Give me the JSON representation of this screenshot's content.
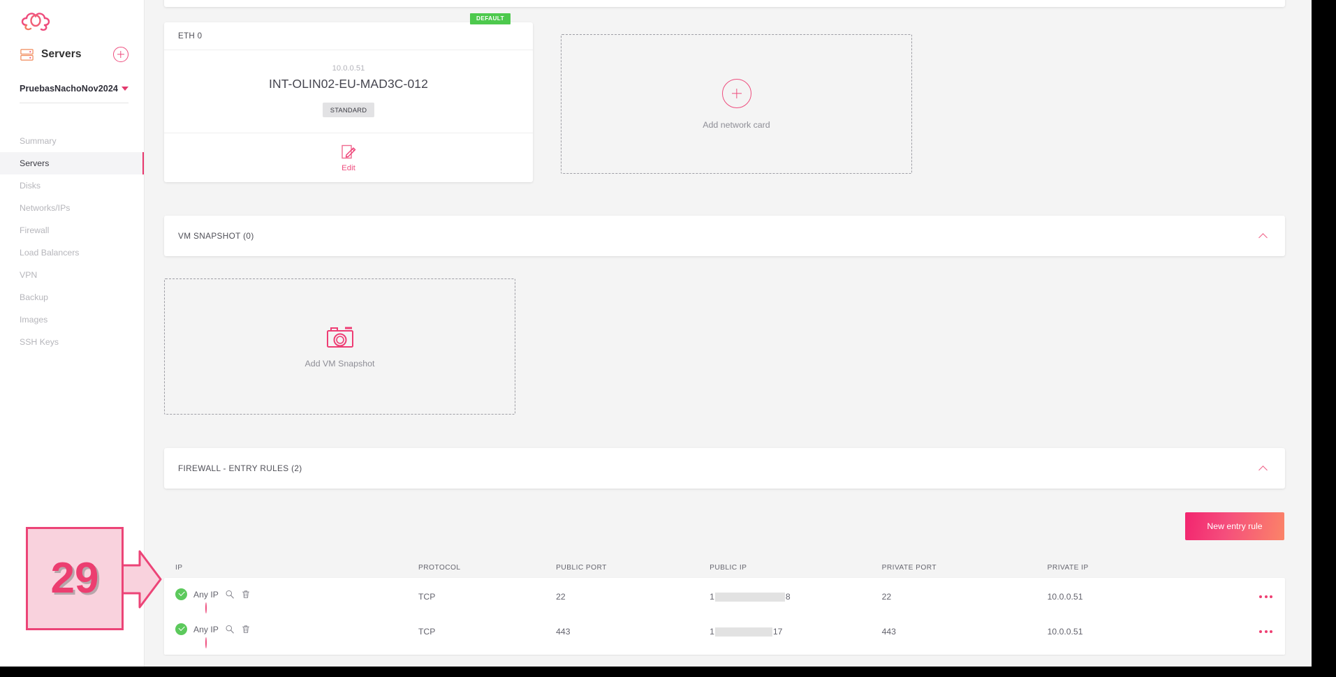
{
  "sidebar": {
    "logo_icon": "cloud-logo-icon",
    "header": {
      "icon": "server-rack-icon",
      "title": "Servers",
      "add_icon": "plus-circle-icon"
    },
    "project": {
      "name": "PruebasNachoNov2024",
      "caret_icon": "caret-down-icon"
    },
    "items": [
      {
        "label": "Summary",
        "active": false
      },
      {
        "label": "Servers",
        "active": true
      },
      {
        "label": "Disks",
        "active": false
      },
      {
        "label": "Networks/IPs",
        "active": false
      },
      {
        "label": "Firewall",
        "active": false
      },
      {
        "label": "Load Balancers",
        "active": false
      },
      {
        "label": "VPN",
        "active": false
      },
      {
        "label": "Backup",
        "active": false
      },
      {
        "label": "Images",
        "active": false
      },
      {
        "label": "SSH Keys",
        "active": false
      }
    ]
  },
  "network": {
    "eth_card": {
      "title": "ETH 0",
      "badge": "DEFAULT",
      "ip": "10.0.0.51",
      "name": "INT-OLIN02-EU-MAD3C-012",
      "tag": "STANDARD",
      "edit_label": "Edit",
      "edit_icon": "edit-pencil-icon"
    },
    "add_card": {
      "label": "Add network card",
      "icon": "plus-circle-icon"
    }
  },
  "vm_snapshot": {
    "section_title": "VM SNAPSHOT (0)",
    "collapse_icon": "chevron-up-icon",
    "dropzone": {
      "label": "Add VM Snapshot",
      "icon": "camera-icon"
    }
  },
  "firewall": {
    "section_title": "FIREWALL - ENTRY RULES (2)",
    "collapse_icon": "chevron-up-icon",
    "new_rule_button": "New entry rule",
    "columns": [
      "IP",
      "PROTOCOL",
      "PUBLIC PORT",
      "PUBLIC IP",
      "PRIVATE PORT",
      "PRIVATE IP"
    ],
    "rows": [
      {
        "status_icon": "check-circle-icon",
        "ip": "Any IP",
        "search_icon": "magnifier-icon",
        "delete_icon": "trash-icon",
        "add_icon": "plus-circle-icon",
        "protocol": "TCP",
        "public_port": "22",
        "public_ip_prefix": "1",
        "public_ip_suffix": "8",
        "private_port": "22",
        "private_ip": "10.0.0.51",
        "menu_icon": "more-dots-icon"
      },
      {
        "status_icon": "check-circle-icon",
        "ip": "Any IP",
        "search_icon": "magnifier-icon",
        "delete_icon": "trash-icon",
        "add_icon": "plus-circle-icon",
        "protocol": "TCP",
        "public_port": "443",
        "public_ip_prefix": "1",
        "public_ip_suffix": "17",
        "private_port": "443",
        "private_ip": "10.0.0.51",
        "menu_icon": "more-dots-icon"
      }
    ]
  },
  "annotation": {
    "number": "29",
    "arrow_icon": "right-arrow-callout-icon"
  },
  "colors": {
    "accent_pink": "#ee4d7e",
    "badge_green": "#4dc94d",
    "status_green": "#5cc95c",
    "gradient_start": "#f2256f",
    "gradient_end": "#fb8468"
  }
}
